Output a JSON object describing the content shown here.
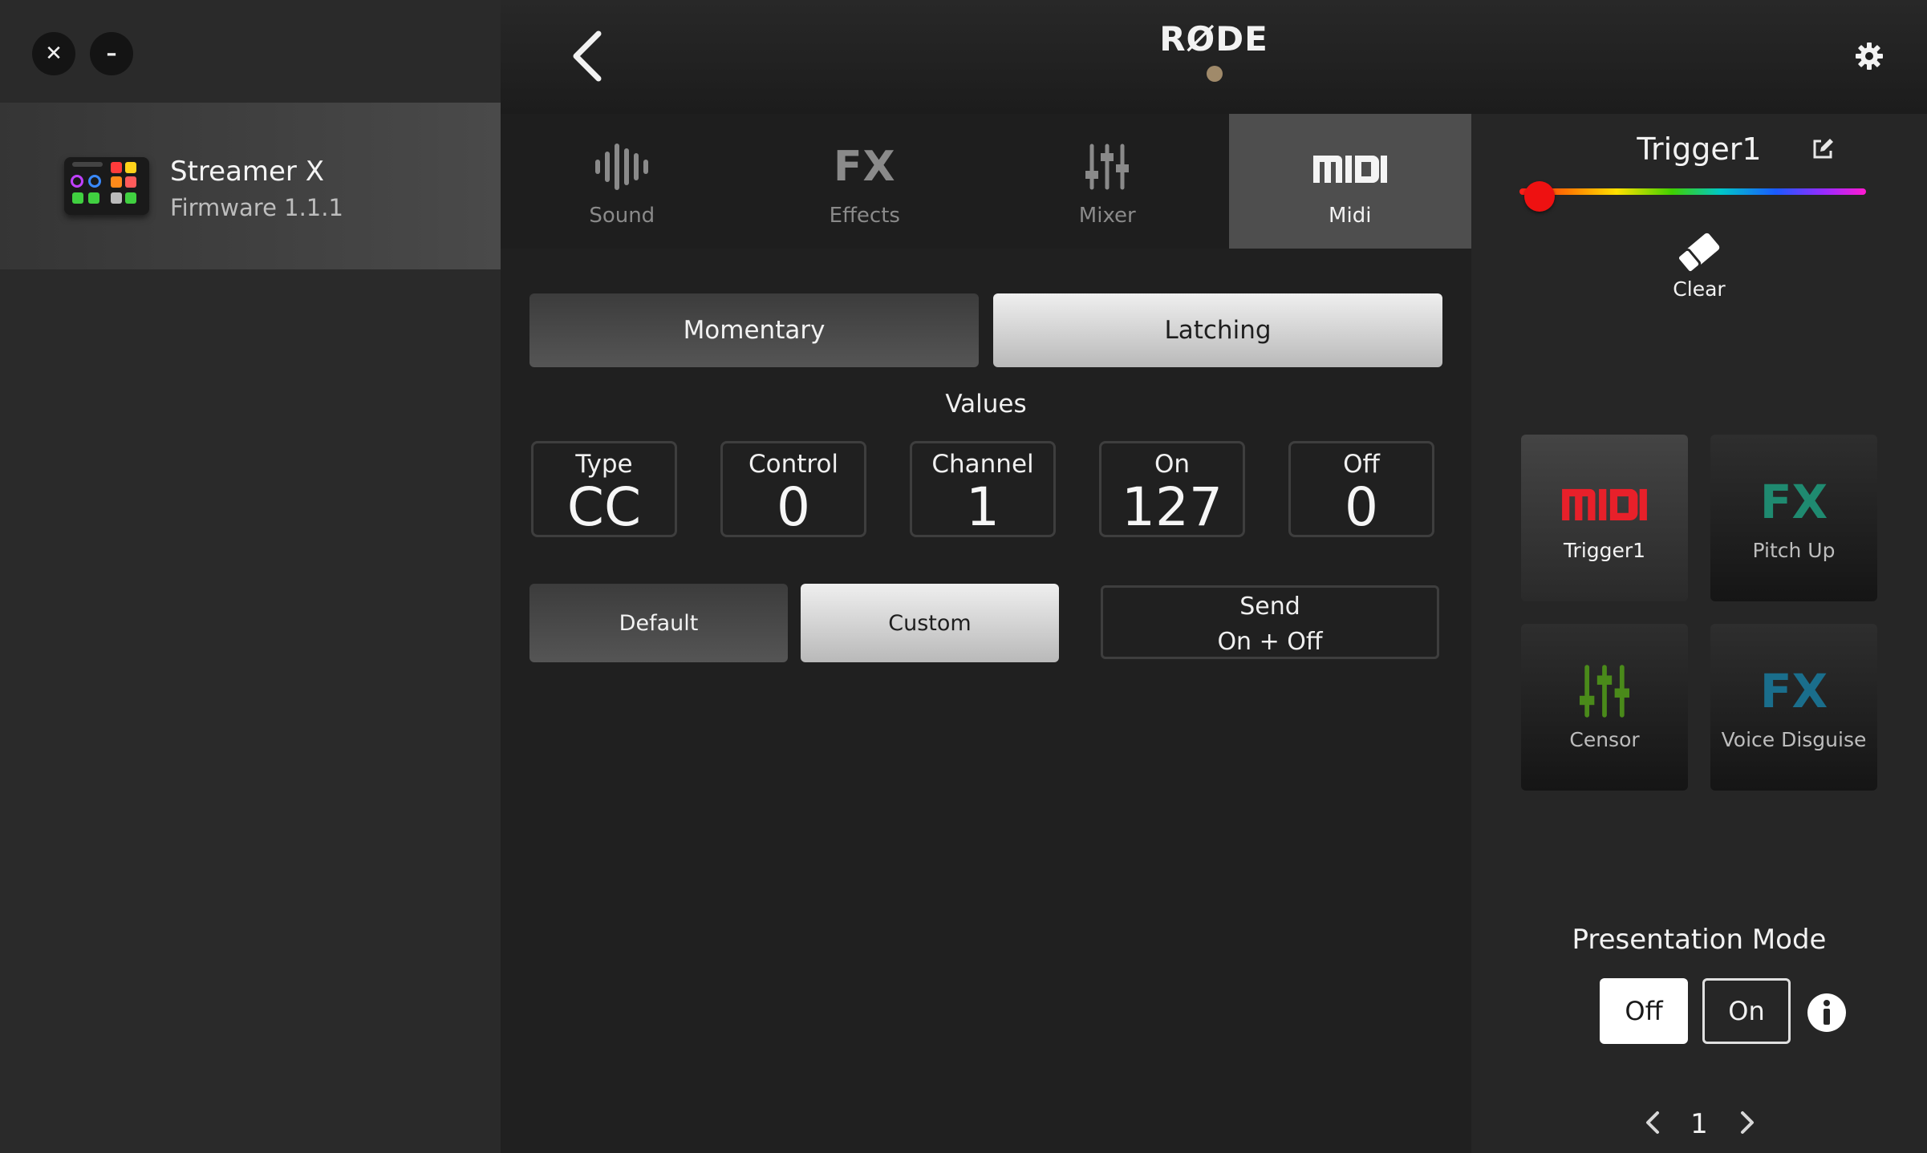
{
  "window": {
    "close_label": "✕",
    "minimize_label": "–"
  },
  "sidebar": {
    "device": {
      "name": "Streamer X",
      "firmware": "Firmware 1.1.1"
    }
  },
  "header": {
    "brand": "RØDE"
  },
  "tabs": [
    {
      "label": "Sound",
      "icon": "waveform-icon",
      "active": false
    },
    {
      "label": "Effects",
      "icon": "fx-icon",
      "active": false,
      "icon_text": "FX"
    },
    {
      "label": "Mixer",
      "icon": "mixer-sliders-icon",
      "active": false
    },
    {
      "label": "Midi",
      "icon": "midi-icon",
      "active": true
    }
  ],
  "main": {
    "mode": {
      "momentary_label": "Momentary",
      "latching_label": "Latching",
      "selected": "Latching"
    },
    "values_title": "Values",
    "values": [
      {
        "label": "Type",
        "value": "CC"
      },
      {
        "label": "Control",
        "value": "0"
      },
      {
        "label": "Channel",
        "value": "1"
      },
      {
        "label": "On",
        "value": "127"
      },
      {
        "label": "Off",
        "value": "0"
      }
    ],
    "preset": {
      "default_label": "Default",
      "custom_label": "Custom",
      "selected": "Custom"
    },
    "send": {
      "line1": "Send",
      "line2": "On + Off"
    }
  },
  "right_panel": {
    "trigger_name": "Trigger1",
    "color_value": "#ee1111",
    "clear_label": "Clear",
    "pads": [
      {
        "label": "Trigger1",
        "icon": "midi-icon",
        "icon_text": "MIDI",
        "color": "#e8202a",
        "selected": true
      },
      {
        "label": "Pitch Up",
        "icon": "fx-icon",
        "icon_text": "FX",
        "color": "#1f8a70",
        "selected": false
      },
      {
        "label": "Censor",
        "icon": "mixer-sliders-icon",
        "color": "#4a8a1a",
        "selected": false
      },
      {
        "label": "Voice Disguise",
        "icon": "fx-icon",
        "icon_text": "FX",
        "color": "#1a6e8c",
        "selected": false
      }
    ],
    "presentation_mode": {
      "title": "Presentation Mode",
      "off_label": "Off",
      "on_label": "On",
      "selected": "Off"
    },
    "pagination": {
      "current_page": "1"
    }
  },
  "colors": {
    "accent_red": "#e8202a",
    "background": "#202020",
    "sidebar": "#2a2a2a"
  }
}
